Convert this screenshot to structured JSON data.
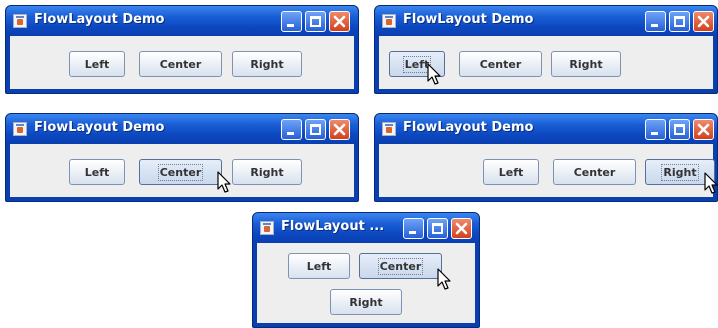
{
  "windows": [
    {
      "title": "FlowLayout Demo",
      "buttons": [
        "Left",
        "Center",
        "Right"
      ],
      "focused_button": null,
      "cursor": false
    },
    {
      "title": "FlowLayout Demo",
      "buttons": [
        "Left",
        "Center",
        "Right"
      ],
      "focused_button": "Left",
      "cursor": true
    },
    {
      "title": "FlowLayout Demo",
      "buttons": [
        "Left",
        "Center",
        "Right"
      ],
      "focused_button": "Center",
      "cursor": true
    },
    {
      "title": "FlowLayout Demo",
      "buttons": [
        "Left",
        "Center",
        "Right"
      ],
      "focused_button": "Right",
      "cursor": true
    },
    {
      "title": "FlowLayout ...",
      "buttons": [
        "Left",
        "Center",
        "Right"
      ],
      "focused_button": "Center",
      "cursor": true
    }
  ],
  "icons": {
    "app": "java-cup-icon",
    "minimize": "minimize-icon",
    "maximize": "maximize-icon",
    "close": "close-icon",
    "pointer": "mouse-pointer-icon"
  },
  "colors": {
    "titlebar": "#1a5ed6",
    "client": "#eeeeee",
    "close_button": "#d2401d"
  }
}
